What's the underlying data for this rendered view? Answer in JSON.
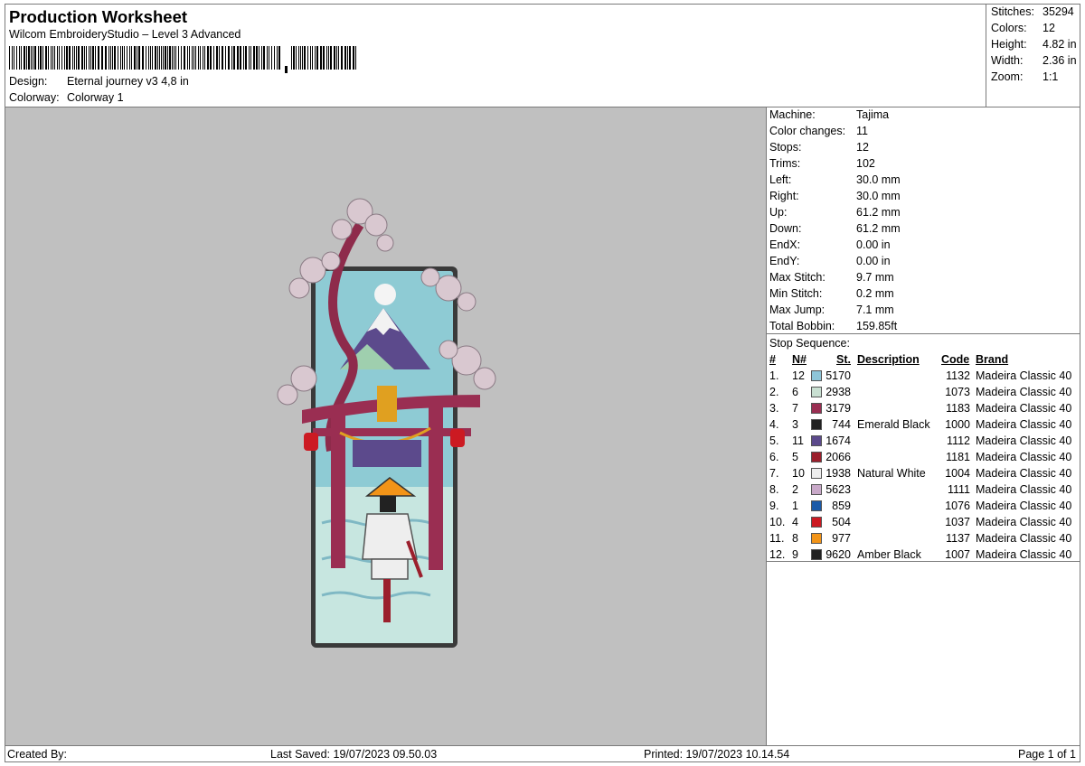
{
  "header": {
    "title": "Production Worksheet",
    "software": "Wilcom EmbroideryStudio – Level 3 Advanced",
    "design_label": "Design:",
    "design_value": "Eternal journey v3 4,8 in",
    "colorway_label": "Colorway:",
    "colorway_value": "Colorway 1"
  },
  "stats": [
    {
      "label": "Stitches:",
      "value": "35294"
    },
    {
      "label": "Colors:",
      "value": "12"
    },
    {
      "label": "Height:",
      "value": "4.82 in"
    },
    {
      "label": "Width:",
      "value": "2.36 in"
    },
    {
      "label": "Zoom:",
      "value": "1:1"
    }
  ],
  "machine_info": [
    {
      "label": "Machine:",
      "value": "Tajima"
    },
    {
      "label": "Color changes:",
      "value": "11"
    },
    {
      "label": "Stops:",
      "value": "12"
    },
    {
      "label": "Trims:",
      "value": "102"
    },
    {
      "label": "Left:",
      "value": "30.0 mm"
    },
    {
      "label": "Right:",
      "value": "30.0 mm"
    },
    {
      "label": "Up:",
      "value": "61.2 mm"
    },
    {
      "label": "Down:",
      "value": "61.2 mm"
    },
    {
      "label": "EndX:",
      "value": "0.00 in"
    },
    {
      "label": "EndY:",
      "value": "0.00 in"
    },
    {
      "label": "Max Stitch:",
      "value": "9.7 mm"
    },
    {
      "label": "Min Stitch:",
      "value": "0.2 mm"
    },
    {
      "label": "Max Jump:",
      "value": "7.1 mm"
    },
    {
      "label": "Total Bobbin:",
      "value": "159.85ft"
    }
  ],
  "stop_sequence": {
    "title": "Stop Sequence:",
    "headers": {
      "idx": "#",
      "n": "N#",
      "st": "St.",
      "desc": "Description",
      "code": "Code",
      "brand": "Brand"
    },
    "rows": [
      {
        "idx": "1.",
        "n": "12",
        "color": "#8ec5d8",
        "st": "5170",
        "desc": "",
        "code": "1132",
        "brand": "Madeira Classic 40"
      },
      {
        "idx": "2.",
        "n": "6",
        "color": "#c9e0d2",
        "st": "2938",
        "desc": "",
        "code": "1073",
        "brand": "Madeira Classic 40"
      },
      {
        "idx": "3.",
        "n": "7",
        "color": "#9a2e52",
        "st": "3179",
        "desc": "",
        "code": "1183",
        "brand": "Madeira Classic 40"
      },
      {
        "idx": "4.",
        "n": "3",
        "color": "#222222",
        "st": "744",
        "desc": "Emerald Black",
        "code": "1000",
        "brand": "Madeira Classic 40"
      },
      {
        "idx": "5.",
        "n": "11",
        "color": "#5c4a8c",
        "st": "1674",
        "desc": "",
        "code": "1112",
        "brand": "Madeira Classic 40"
      },
      {
        "idx": "6.",
        "n": "5",
        "color": "#9b1f2c",
        "st": "2066",
        "desc": "",
        "code": "1181",
        "brand": "Madeira Classic 40"
      },
      {
        "idx": "7.",
        "n": "10",
        "color": "#eeeeee",
        "st": "1938",
        "desc": "Natural White",
        "code": "1004",
        "brand": "Madeira Classic 40"
      },
      {
        "idx": "8.",
        "n": "2",
        "color": "#c9a9c9",
        "st": "5623",
        "desc": "",
        "code": "1111",
        "brand": "Madeira Classic 40"
      },
      {
        "idx": "9.",
        "n": "1",
        "color": "#1b5aa8",
        "st": "859",
        "desc": "",
        "code": "1076",
        "brand": "Madeira Classic 40"
      },
      {
        "idx": "10.",
        "n": "4",
        "color": "#cc1a22",
        "st": "504",
        "desc": "",
        "code": "1037",
        "brand": "Madeira Classic 40"
      },
      {
        "idx": "11.",
        "n": "8",
        "color": "#f29418",
        "st": "977",
        "desc": "",
        "code": "1137",
        "brand": "Madeira Classic 40"
      },
      {
        "idx": "12.",
        "n": "9",
        "color": "#222222",
        "st": "9620",
        "desc": "Amber Black",
        "code": "1007",
        "brand": "Madeira Classic 40"
      }
    ]
  },
  "footer": {
    "created_by": "Created By:",
    "last_saved": "Last Saved: 19/07/2023 09.50.03",
    "printed": "Printed: 19/07/2023 10.14.54",
    "page": "Page 1 of 1"
  }
}
